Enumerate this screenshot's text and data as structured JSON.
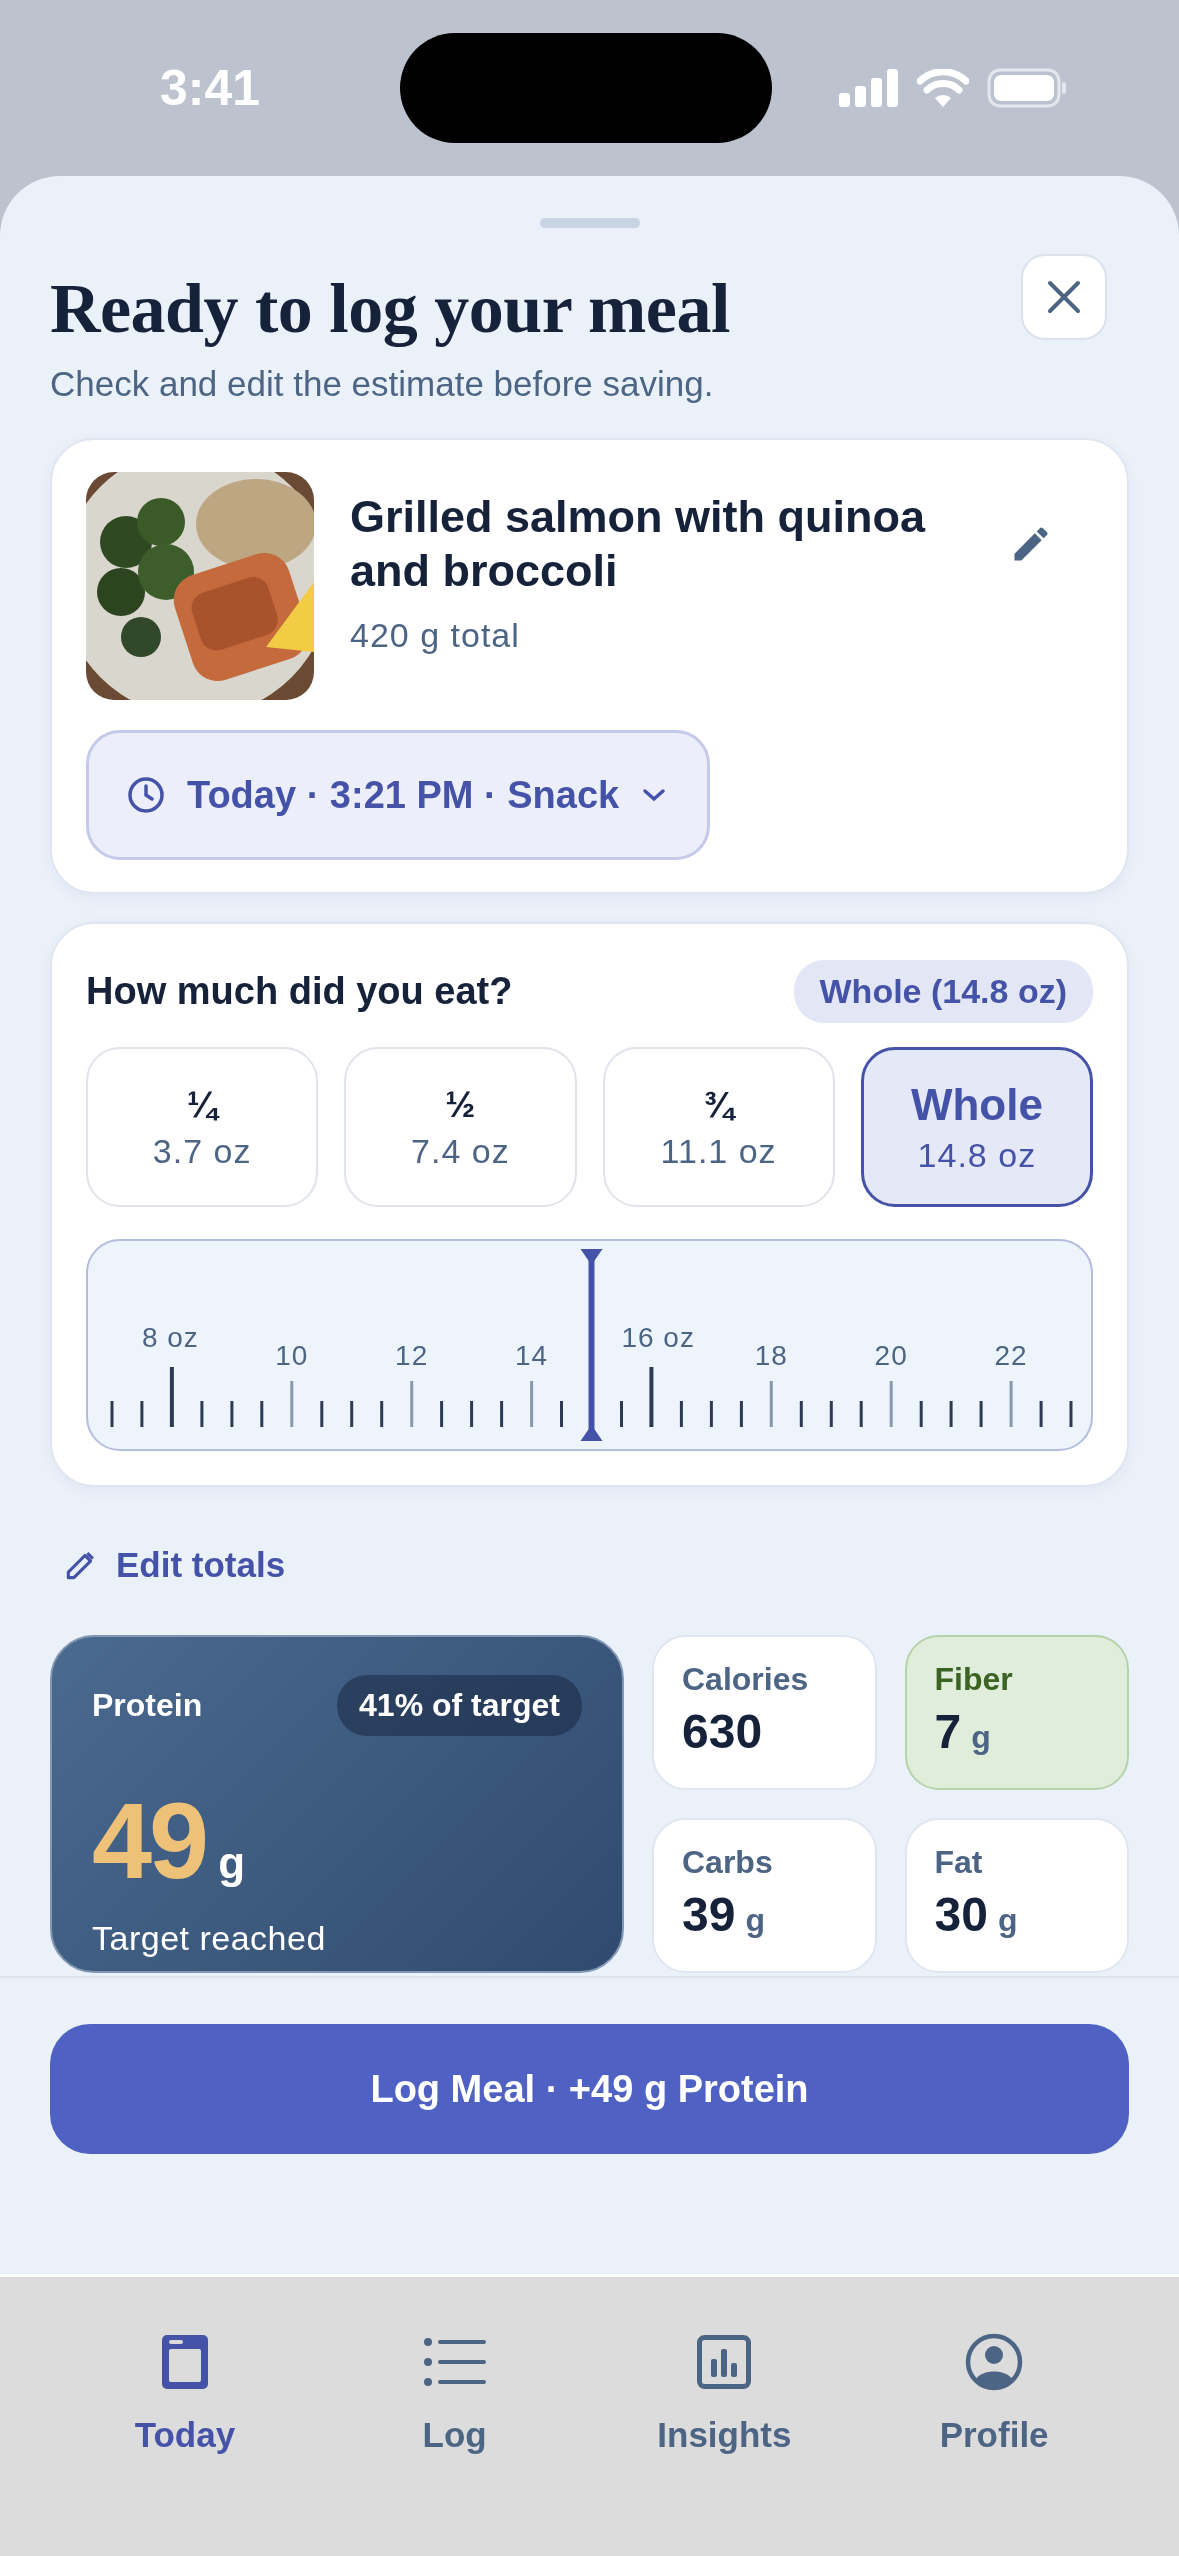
{
  "status_bar": {
    "time": "3:41"
  },
  "sheet": {
    "title": "Ready to log your meal",
    "subtitle": "Check and edit the estimate before saving."
  },
  "meal": {
    "name": "Grilled salmon with quinoa and broccoli",
    "weight": "420 g total",
    "when": "Today · 3:21 PM · Snack"
  },
  "portion": {
    "question": "How much did you eat?",
    "summary": "Whole (14.8 oz)",
    "options": [
      {
        "fraction": "¼",
        "amount": "3.7 oz",
        "selected": false
      },
      {
        "fraction": "½",
        "amount": "7.4 oz",
        "selected": false
      },
      {
        "fraction": "¾",
        "amount": "11.1 oz",
        "selected": false
      },
      {
        "fraction": "Whole",
        "amount": "14.8 oz",
        "selected": true
      }
    ],
    "ruler": {
      "level": 0.5,
      "labels": [
        "8 oz",
        "10",
        "12",
        "14",
        "16 oz",
        "18",
        "20",
        "22"
      ]
    }
  },
  "edit_totals": "Edit totals",
  "protein": {
    "label": "Protein",
    "badge": "41% of target",
    "value": "49",
    "unit": "g",
    "note": "Target reached"
  },
  "nutrients": [
    {
      "label": "Calories",
      "value": "630",
      "highlight": false
    },
    {
      "label": "Fiber",
      "value": "7",
      "unit": "g",
      "highlight": true
    },
    {
      "label": "Carbs",
      "value": "39",
      "unit": "g",
      "highlight": false
    },
    {
      "label": "Fat",
      "value": "30",
      "unit": "g",
      "highlight": false
    }
  ],
  "log_button": "Log Meal · +49 g Protein",
  "tabs": [
    {
      "label": "Today",
      "selected": true
    },
    {
      "label": "Log",
      "selected": false
    },
    {
      "label": "Insights",
      "selected": false
    },
    {
      "label": "Profile",
      "selected": false
    }
  ]
}
